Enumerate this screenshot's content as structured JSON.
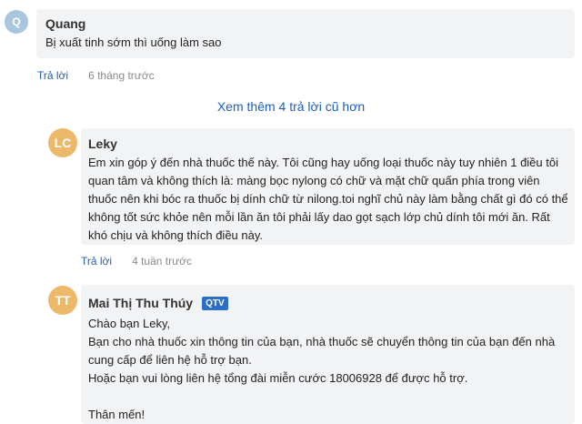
{
  "comments": [
    {
      "avatar_initials": "Q",
      "avatar_color": "#a9c7dc",
      "name": "Quang",
      "text": "Bị xuất tinh sớm thì uống làm sao",
      "reply_label": "Trả lời",
      "time": "6 tháng trước"
    },
    {
      "avatar_initials": "LC",
      "avatar_color": "#ecb86a",
      "name": "Leky",
      "text": "Em xin góp ý đến nhà thuốc thế này. Tôi cũng hay uống loại thuốc này tuy nhiên 1 điều tôi quan tâm và không thích là: màng bọc nylong có chữ và mặt chữ quấn phía trong viên thuốc nên khi bóc ra thuốc bị dính chữ từ nilong.toi nghĩ chủ này làm bằng chất gì đó có thể không tốt sức khỏe nên mỗi lần ăn tôi phải lấy dao gọt sạch lớp chủ dính tôi mới ăn. Rất khó chịu và không thích điều này.",
      "reply_label": "Trả lời",
      "time": "4 tuần trước"
    },
    {
      "avatar_initials": "TT",
      "avatar_color": "#ecb86a",
      "name": "Mai Thị Thu Thúy",
      "badge": "QTV",
      "badge_color": "#2b6fc9",
      "lines": [
        "Chào bạn Leky,",
        "Bạn cho nhà thuốc xin thông tin của bạn, nhà thuốc sẽ chuyển thông tin của bạn đến nhà cung cấp để liên hệ hỗ trợ bạn.",
        "Hoặc bạn vui lòng liên hệ tổng đài miễn cước 18006928 để được hỗ trợ.",
        "",
        "Thân mến!"
      ]
    }
  ],
  "load_more_label": "Xem thêm 4 trả lời cũ hơn"
}
